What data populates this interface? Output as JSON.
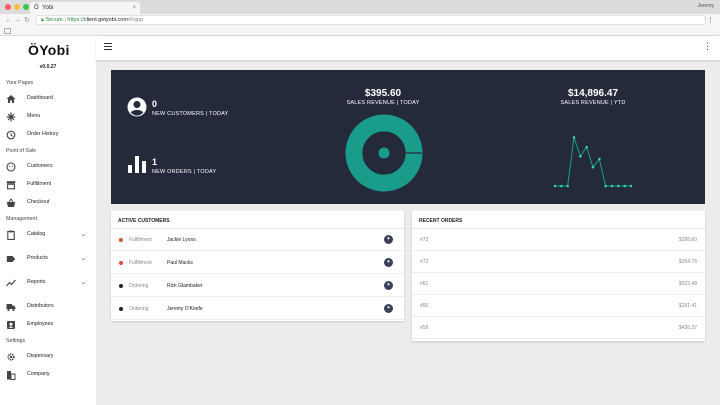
{
  "browser": {
    "tab_title": "Yobi",
    "tab_icon": "Ö",
    "tab_close": "×",
    "profile": "Jeremy",
    "secure_label": "Secure",
    "url_separator": "|",
    "url_scheme": "https://",
    "url_host": "client.getyobi.com",
    "url_path": "/#/app",
    "traffic_lights": [
      "#fc605b",
      "#fdbc40",
      "#34c84a"
    ]
  },
  "brand": {
    "logo": "ÖYobi",
    "version": "v0.0.27"
  },
  "sidebar": {
    "sections": [
      {
        "label": "Your Pages",
        "items": [
          {
            "label": "Dashboard",
            "icon": "home-icon"
          },
          {
            "label": "Menu",
            "icon": "utensils-icon"
          },
          {
            "label": "Order History",
            "icon": "history-icon"
          }
        ]
      },
      {
        "label": "Point of Sale",
        "items": [
          {
            "label": "Customers",
            "icon": "face-icon"
          },
          {
            "label": "Fulfillment",
            "icon": "store-icon"
          },
          {
            "label": "Checkout",
            "icon": "basket-icon"
          }
        ]
      },
      {
        "label": "Management",
        "items": [
          {
            "label": "Catalog",
            "icon": "clipboard-icon",
            "expandable": true
          },
          {
            "label": "Products",
            "icon": "tag-icon",
            "expandable": true
          },
          {
            "label": "Reports",
            "icon": "trending-icon",
            "expandable": true
          },
          {
            "label": "Distributors",
            "icon": "truck-icon"
          },
          {
            "label": "Employees",
            "icon": "badge-icon"
          }
        ]
      },
      {
        "label": "Settings",
        "items": [
          {
            "label": "Dispensary",
            "icon": "gear-icon"
          },
          {
            "label": "Company",
            "icon": "building-icon"
          }
        ]
      }
    ]
  },
  "appbar": {
    "kebab": "⋮"
  },
  "stats": {
    "new_customers_value": "0",
    "new_customers_label": "NEW CUSTOMERS | TODAY",
    "new_orders_value": "1",
    "new_orders_label": "NEW ORDERS | TODAY",
    "sales_today_value": "$395.60",
    "sales_today_label": "SALES REVENUE | TODAY",
    "sales_ytd_value": "$14,896.47",
    "sales_ytd_label": "SALES REVENUE | YTD"
  },
  "colors": {
    "hero_bg": "#252a3b",
    "accent_teal": "#1a9c8a",
    "sparkline": "#2ed3b7",
    "status_fulfillment": "#e24b3b",
    "status_ordering": "#222222"
  },
  "active_customers": {
    "title": "ACTIVE CUSTOMERS",
    "rows": [
      {
        "status": "Fulfillment",
        "name": "Jackie Lyons",
        "status_color": "#e24b3b"
      },
      {
        "status": "Fulfillment",
        "name": "Paul Macks",
        "status_color": "#e24b3b"
      },
      {
        "status": "Ordering",
        "name": "Rick Glambaker",
        "status_color": "#222222"
      },
      {
        "status": "Ordering",
        "name": "Jeremy O'Keefe",
        "status_color": "#222222"
      }
    ]
  },
  "recent_orders": {
    "title": "RECENT ORDERS",
    "rows": [
      {
        "id": "#73",
        "amount": "$395.60"
      },
      {
        "id": "#72",
        "amount": "$354.76"
      },
      {
        "id": "#61",
        "amount": "$523.48"
      },
      {
        "id": "#60",
        "amount": "$291.41"
      },
      {
        "id": "#59",
        "amount": "$426.37"
      }
    ]
  },
  "sparkline_values": [
    0,
    0,
    0,
    0.9,
    0.55,
    0.72,
    0.35,
    0.5,
    0,
    0,
    0,
    0,
    0
  ]
}
